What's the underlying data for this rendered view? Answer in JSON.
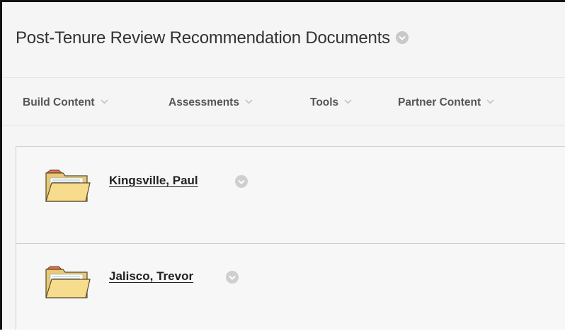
{
  "page": {
    "title": "Post-Tenure Review Recommendation Documents",
    "title_menu_icon": "chevron-down-circle-icon"
  },
  "action_bar": {
    "items": [
      {
        "label": "Build Content",
        "icon": "chevron-down-icon"
      },
      {
        "label": "Assessments",
        "icon": "chevron-down-icon"
      },
      {
        "label": "Tools",
        "icon": "chevron-down-icon"
      },
      {
        "label": "Partner Content",
        "icon": "chevron-down-icon"
      }
    ]
  },
  "content_items": [
    {
      "title": "Kingsville, Paul",
      "icon": "folder-icon",
      "menu_icon": "chevron-down-circle-icon"
    },
    {
      "title": "Jalisco, Trevor",
      "icon": "folder-icon",
      "menu_icon": "chevron-down-circle-icon"
    }
  ],
  "colors": {
    "background": "#f5f5f5",
    "title_text": "#333333",
    "action_text": "#555555",
    "link_text": "#222222",
    "chevron_circle": "#c9c9c9",
    "folder_body": "#f6dc8c",
    "folder_tab_accent": "#e8704c"
  }
}
